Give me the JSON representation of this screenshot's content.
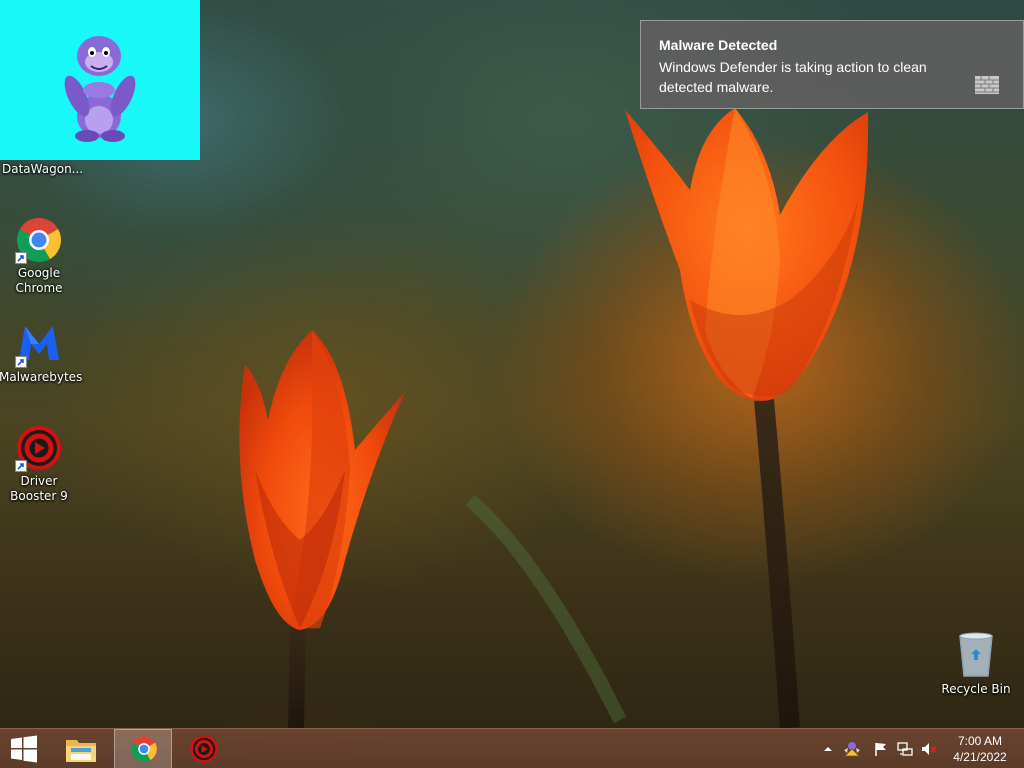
{
  "desktop": {
    "icons": [
      {
        "label": "DataWagon...",
        "icon": "bonzi-buddy-icon"
      },
      {
        "label": "Google Chrome",
        "icon": "chrome-icon"
      },
      {
        "label": "Malwarebytes",
        "icon": "malwarebytes-icon"
      },
      {
        "label": "Driver Booster 9",
        "icon": "driver-booster-icon"
      }
    ],
    "recycle_bin": {
      "label": "Recycle Bin",
      "icon": "recycle-bin-icon"
    }
  },
  "toast": {
    "title": "Malware Detected",
    "body": "Windows Defender is taking action to clean detected malware.",
    "icon": "defender-wall-icon"
  },
  "taskbar": {
    "start": {
      "icon": "windows-logo-icon"
    },
    "pinned": [
      {
        "name": "File Explorer",
        "icon": "file-explorer-icon",
        "active": false
      },
      {
        "name": "Google Chrome",
        "icon": "chrome-icon",
        "active": true
      },
      {
        "name": "Driver Booster",
        "icon": "driver-booster-icon",
        "active": false
      }
    ],
    "tray": {
      "icons": [
        "show-hidden-icon",
        "bonzi-tray-icon",
        "action-center-flag-icon",
        "network-icon",
        "volume-muted-icon"
      ],
      "time": "7:00 AM",
      "date": "4/21/2022"
    }
  },
  "colors": {
    "selection": "#18f8f8",
    "toast_bg": "#5f5f5f",
    "taskbar": "#6e4632"
  }
}
